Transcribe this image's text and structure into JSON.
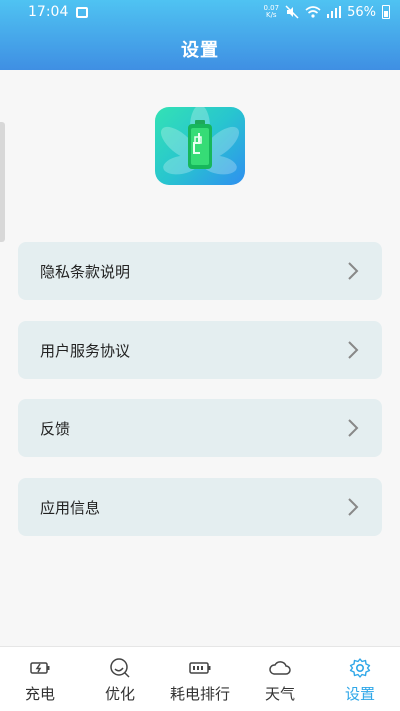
{
  "status_bar": {
    "time": "17:04",
    "speed_value": "0.07",
    "speed_unit": "K/s",
    "battery": "56%"
  },
  "header": {
    "title": "设置"
  },
  "menu": [
    {
      "label": "隐私条款说明"
    },
    {
      "label": "用户服务协议"
    },
    {
      "label": "反馈"
    },
    {
      "label": "应用信息"
    }
  ],
  "tabs": [
    {
      "label": "充电",
      "icon": "charge-icon",
      "active": false
    },
    {
      "label": "优化",
      "icon": "optimize-icon",
      "active": false
    },
    {
      "label": "耗电排行",
      "icon": "battery-rank-icon",
      "active": false
    },
    {
      "label": "天气",
      "icon": "cloud-icon",
      "active": false
    },
    {
      "label": "设置",
      "icon": "gear-icon",
      "active": true
    }
  ],
  "colors": {
    "header_top": "#4fc3f2",
    "header_bottom": "#3f8fe3",
    "menu_bg": "#e4eef0",
    "active_tab": "#2fa7e8"
  }
}
